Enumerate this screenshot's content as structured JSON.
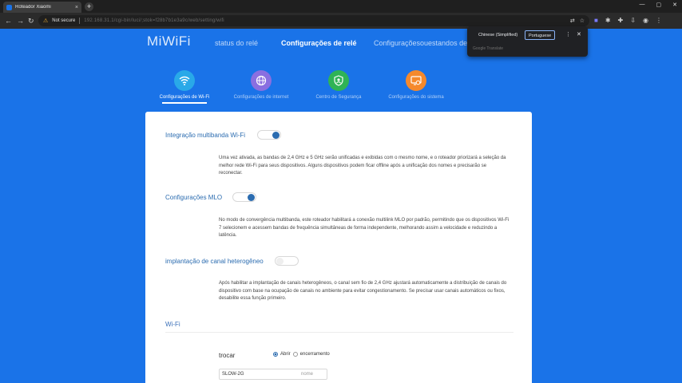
{
  "browser": {
    "tab_title": "Roteador Xiaomi",
    "new_tab": "+",
    "tab_close": "×",
    "window_controls": [
      "—",
      "▢",
      "✕"
    ],
    "not_secure": "Not secure",
    "url_text": "192.168.31.1/cgi-bin/luci/;stok=f28b7b1e3a9c/web/setting/wifi"
  },
  "translate_popup": {
    "source_language": "Chinese (Simplified)",
    "target_language": "Portuguese",
    "brand": "Google Translate"
  },
  "header": {
    "logo": "MiWiFi",
    "nav": {
      "status": "status do relé",
      "settings": "Configurações de relé",
      "overlap": "Configuraçõesouestandos de malha"
    }
  },
  "tiles": [
    {
      "label": "Configurações de Wi-Fi",
      "color": "#29a9e8"
    },
    {
      "label": "Configurações de internet",
      "color": "#8a6fe0"
    },
    {
      "label": "Centro de Segurança",
      "color": "#2fb356"
    },
    {
      "label": "Configurações do sistema",
      "color": "#f5892c"
    }
  ],
  "settings": {
    "multiband": {
      "label": "Integração multibanda Wi-Fi",
      "enabled": true,
      "desc": "Uma vez ativada, as bandas de 2,4 GHz e 5 GHz serão unificadas e exibidas com o mesmo nome, e o roteador priorizará a seleção da melhor rede Wi-Fi para seus dispositivos. Alguns dispositivos podem ficar offline após a unificação dos nomes e precisarão se reconectar."
    },
    "mlo": {
      "label": "Configurações MLO",
      "enabled": true,
      "desc": "No modo de convergência multibanda, este roteador habilitará a conexão multilink MLO por padrão, permitindo que os dispositivos Wi-Fi 7 selecionem e acessem bandas de frequência simultâneas de forma independente, melhorando assim a velocidade e reduzindo a latência."
    },
    "hetero": {
      "label": "implantação de canal heterogêneo",
      "enabled": false,
      "desc": "Após habilitar a implantação de canais heterogêneos, o canal sem fio de 2,4 GHz ajustará automaticamente a distribuição de canais do dispositivo com base na ocupação de canais no ambiente para evitar congestionamento. Se precisar usar canais automáticos ou fixos, desabilite essa função primeiro."
    }
  },
  "wifi": {
    "section_title": "Wi-Fi",
    "switch_label": "trocar",
    "radio_on": "Abrir",
    "radio_off": "encerramento",
    "ssid_value": "SLOW-2G",
    "ssid_placeholder": "nome"
  }
}
